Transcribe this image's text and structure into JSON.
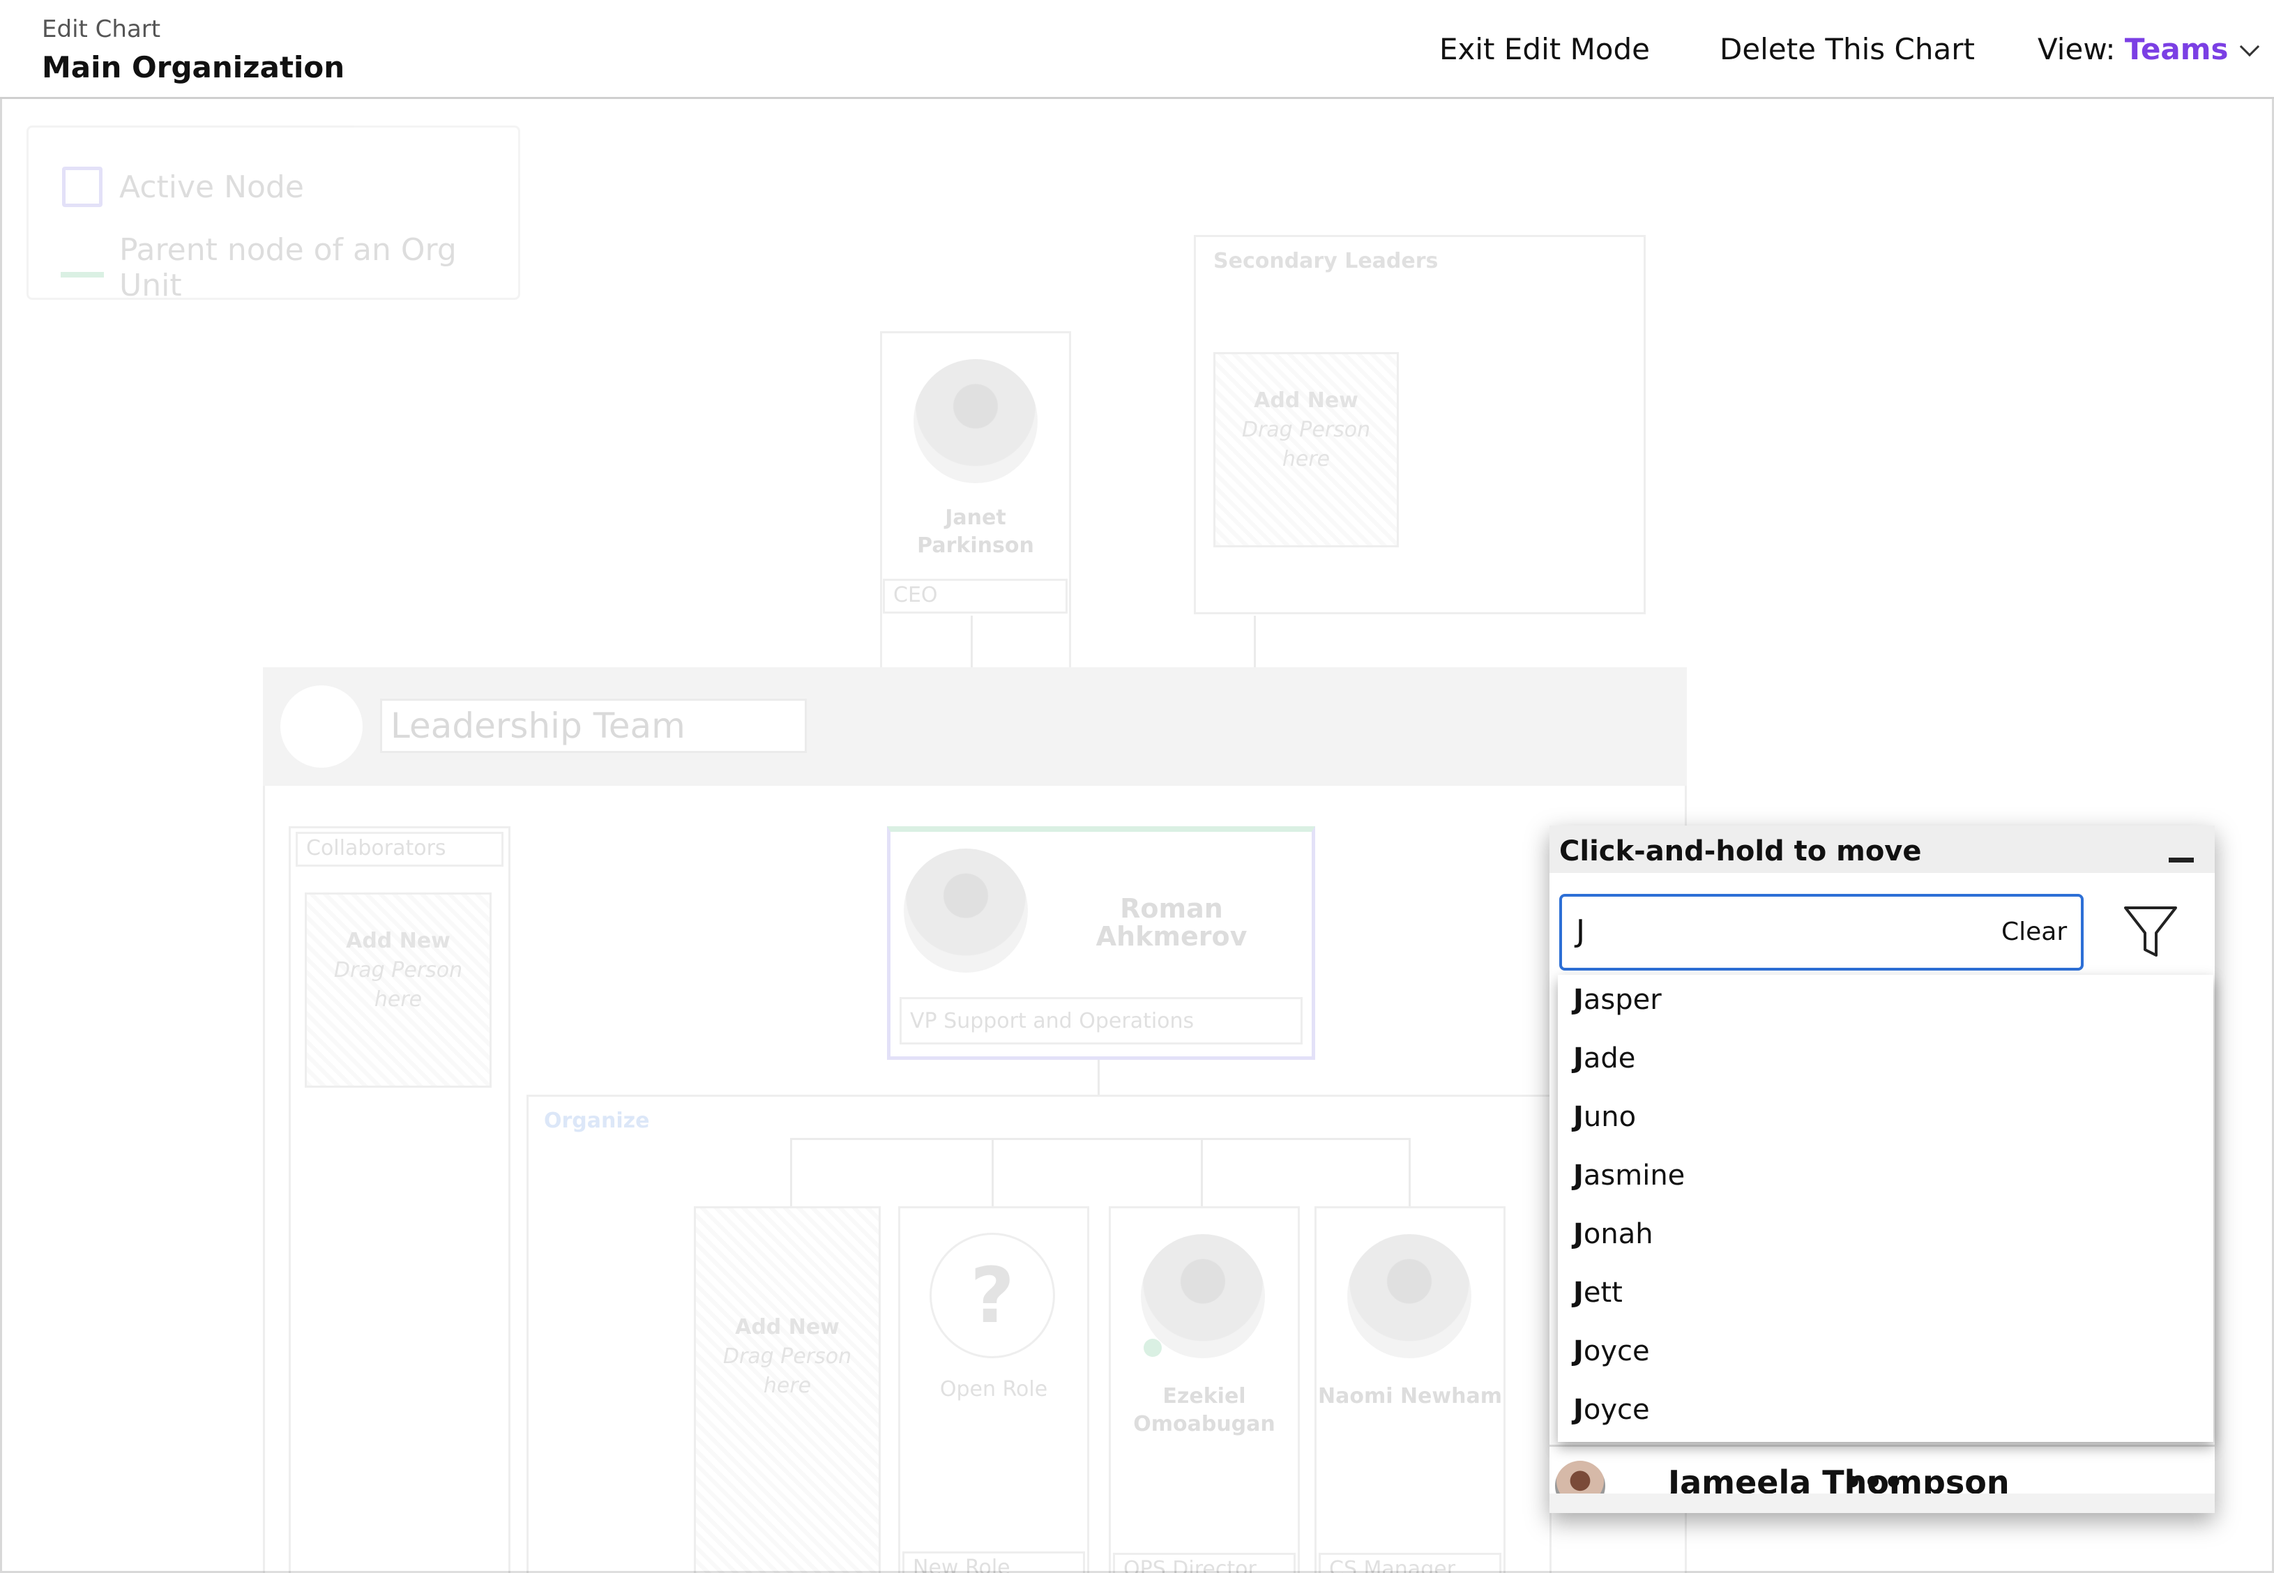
{
  "header": {
    "edit_chart_label": "Edit Chart",
    "chart_name": "Main Organization",
    "exit_edit_mode": "Exit Edit Mode",
    "delete_chart": "Delete This Chart",
    "view_label": "View: ",
    "view_value": "Teams",
    "accent_color": "#7b3fe4"
  },
  "legend": {
    "active_node": "Active Node",
    "parent_node": "Parent node of an Org Unit"
  },
  "chart": {
    "secondary_leaders": "Secondary Leaders",
    "add_new": "Add New",
    "drag_person": "Drag Person here",
    "ceo_name": "Janet Parkinson",
    "ceo_role": "CEO",
    "team_name": "Leadership Team",
    "collaborators": "Collaborators",
    "leader_name": "Roman Ahkmerov",
    "leader_role": "VP Support and Operations",
    "organize": "Organize",
    "open_role_mark": "?",
    "open_role": "Open Role",
    "new_role": "New Role",
    "member1_name": "Ezekiel Omoabugan",
    "member1_role": "OPS Director",
    "member2_name": "Naomi Newham",
    "member2_role": "CS Manager"
  },
  "panel": {
    "title": "Click-and-hold to move",
    "search_value": "J",
    "clear_label": "Clear",
    "filter_icon": "funnel-icon",
    "suggestions": [
      {
        "bold": "J",
        "rest": "asper"
      },
      {
        "bold": "J",
        "rest": "ade"
      },
      {
        "bold": "J",
        "rest": "uno"
      },
      {
        "bold": "J",
        "rest": "asmine"
      },
      {
        "bold": "J",
        "rest": "onah"
      },
      {
        "bold": "J",
        "rest": "ett"
      },
      {
        "bold": "J",
        "rest": "oyce"
      },
      {
        "bold": "J",
        "rest": "oyce"
      }
    ],
    "underlying_person": "Jameela Thompson",
    "more": "•••"
  }
}
